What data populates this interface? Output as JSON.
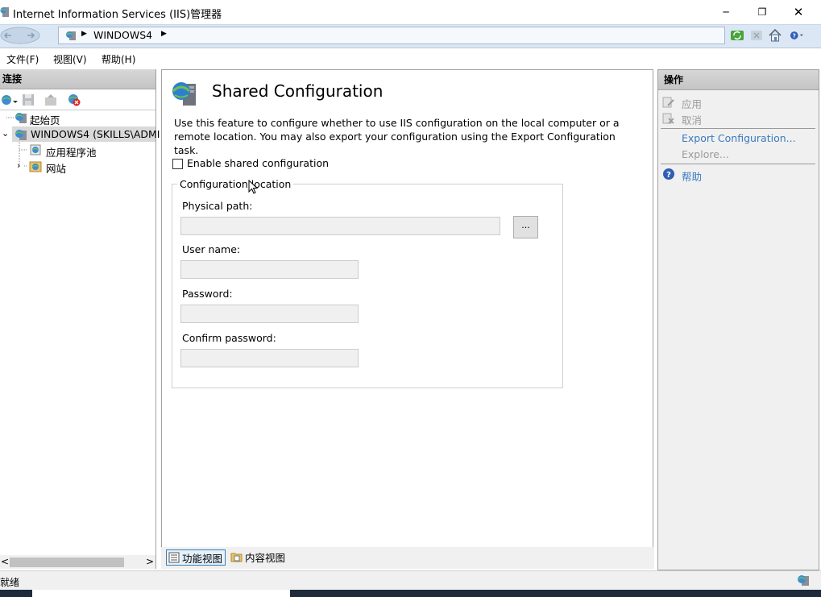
{
  "window": {
    "title": "Internet Information Services (IIS)管理器",
    "controls": {
      "minimize": "─",
      "maximize": "❐",
      "close": "✕"
    }
  },
  "address_bar": {
    "path": "WINDOWS4",
    "separator": "▶"
  },
  "menu": [
    {
      "label": "文件(F)"
    },
    {
      "label": "视图(V)"
    },
    {
      "label": "帮助(H)"
    }
  ],
  "connections": {
    "header": "连接",
    "tree": [
      {
        "label": "起始页",
        "icon": "start-page-icon"
      },
      {
        "label": "WINDOWS4 (SKILLS\\ADMI",
        "icon": "server-icon",
        "expanded": true,
        "selected": true
      },
      {
        "label": "应用程序池",
        "icon": "app-pool-icon"
      },
      {
        "label": "网站",
        "icon": "sites-icon",
        "expanded": false
      }
    ],
    "scroll_left": "<",
    "scroll_right": ">"
  },
  "feature": {
    "title": "Shared Configuration",
    "description": "Use this feature to configure whether to use IIS configuration on the local computer or a remote location. You may also export your configuration using the Export Configuration task.",
    "enable_checkbox": {
      "label": "Enable shared configuration",
      "checked": false
    },
    "group_label": "Configuration location",
    "physical_path_label": "Physical path:",
    "physical_path_value": "",
    "browse_label": "...",
    "user_name_label": "User name:",
    "user_name_value": "",
    "password_label": "Password:",
    "password_value": "",
    "confirm_password_label": "Confirm password:",
    "confirm_password_value": ""
  },
  "view_tabs": [
    {
      "label": "功能视图",
      "active": true
    },
    {
      "label": "内容视图",
      "active": false
    }
  ],
  "actions": {
    "header": "操作",
    "items": [
      {
        "label": "应用",
        "enabled": false
      },
      {
        "label": "取消",
        "enabled": false
      },
      {
        "label": "Export Configuration...",
        "enabled": true
      },
      {
        "label": "Explore...",
        "enabled": false
      },
      {
        "label": "帮助",
        "enabled": true
      }
    ]
  },
  "status": {
    "text": "就绪"
  },
  "colors": {
    "link": "#3a7ac0",
    "disabled": "#9a9a9a",
    "address_bg": "#dbe7f4"
  }
}
